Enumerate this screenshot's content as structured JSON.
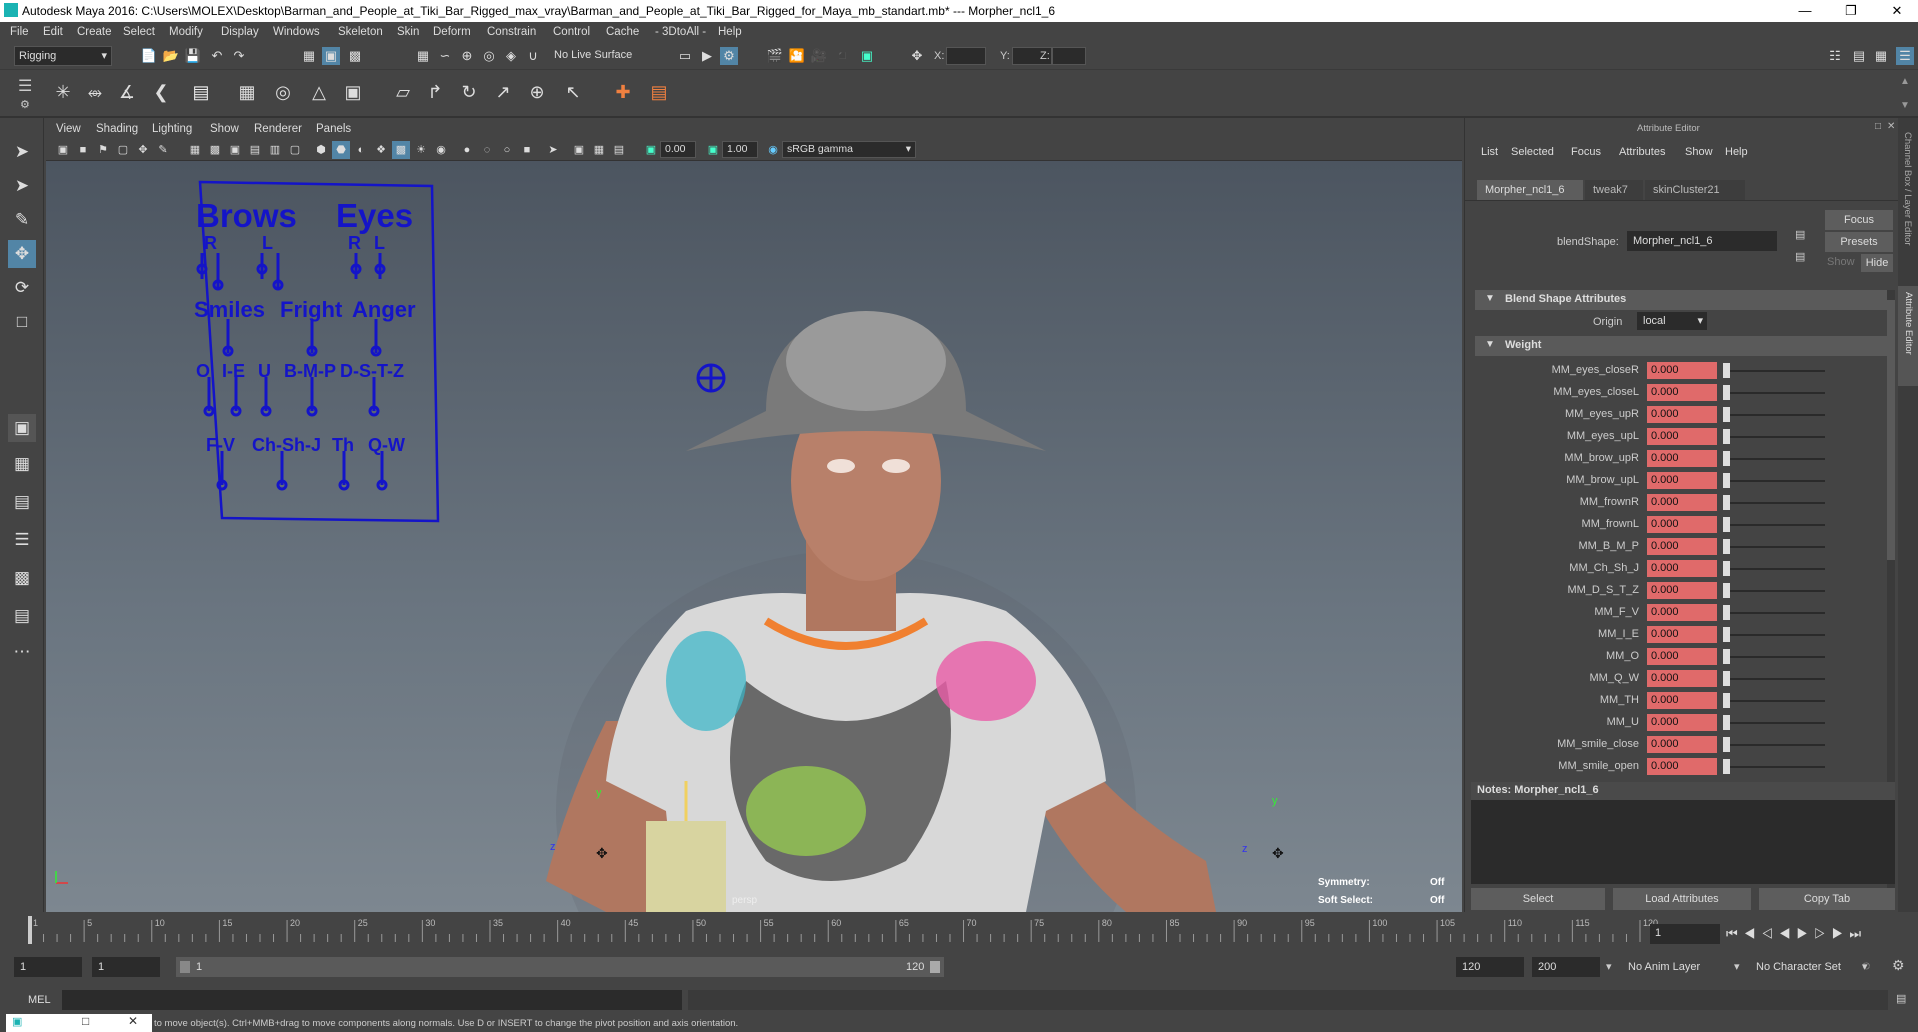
{
  "app": {
    "title": "Autodesk Maya 2016: C:\\Users\\MOLEX\\Desktop\\Barman_and_People_at_Tiki_Bar_Rigged_max_vray\\Barman_and_People_at_Tiki_Bar_Rigged_for_Maya_mb_standart.mb*   ---   Morpher_ncl1_6"
  },
  "menus": [
    "File",
    "Edit",
    "Create",
    "Select",
    "Modify",
    "Display",
    "Windows",
    "Skeleton",
    "Skin",
    "Deform",
    "Constrain",
    "Control",
    "Cache",
    "- 3DtoAll -",
    "Help"
  ],
  "status_line": {
    "mode": "Rigging",
    "live_surface": "No Live Surface",
    "x_label": "X:",
    "y_label": "Y:",
    "z_label": "Z:"
  },
  "viewport": {
    "menus": [
      "View",
      "Shading",
      "Lighting",
      "Show",
      "Renderer",
      "Panels"
    ],
    "exposure": "0.00",
    "gamma": "1.00",
    "color_space": "sRGB gamma",
    "camera": "persp",
    "symmetry_label": "Symmetry:",
    "symmetry_value": "Off",
    "soft_select_label": "Soft Select:",
    "soft_select_value": "Off",
    "face_rig": {
      "brows": "Brows",
      "eyes": "Eyes",
      "r1": "R",
      "l1": "L",
      "r2": "R",
      "l2": "L",
      "smiles": "Smiles",
      "fright": "Fright",
      "anger": "Anger",
      "o": "O",
      "ie": "I-E",
      "u": "U",
      "bmp": "B-M-P",
      "dstz": "D-S-T-Z",
      "fv": "F-V",
      "chshj": "Ch-Sh-J",
      "th": "Th",
      "qw": "Q-W"
    },
    "axis_y": "y",
    "axis_z": "z"
  },
  "attribute_editor": {
    "header": "Attribute Editor",
    "menus": [
      "List",
      "Selected",
      "Focus",
      "Attributes",
      "Show",
      "Help"
    ],
    "tabs": [
      "Morpher_ncl1_6",
      "tweak7",
      "skinCluster21"
    ],
    "node_label": "blendShape:",
    "node_value": "Morpher_ncl1_6",
    "focus_btn": "Focus",
    "presets_btn": "Presets",
    "show_btn": "Show",
    "hide_btn": "Hide",
    "section1": "Blend Shape Attributes",
    "origin_label": "Origin",
    "origin_value": "local",
    "section2": "Weight",
    "weights": [
      {
        "name": "MM_eyes_closeR",
        "value": "0.000"
      },
      {
        "name": "MM_eyes_closeL",
        "value": "0.000"
      },
      {
        "name": "MM_eyes_upR",
        "value": "0.000"
      },
      {
        "name": "MM_eyes_upL",
        "value": "0.000"
      },
      {
        "name": "MM_brow_upR",
        "value": "0.000"
      },
      {
        "name": "MM_brow_upL",
        "value": "0.000"
      },
      {
        "name": "MM_frownR",
        "value": "0.000"
      },
      {
        "name": "MM_frownL",
        "value": "0.000"
      },
      {
        "name": "MM_B_M_P",
        "value": "0.000"
      },
      {
        "name": "MM_Ch_Sh_J",
        "value": "0.000"
      },
      {
        "name": "MM_D_S_T_Z",
        "value": "0.000"
      },
      {
        "name": "MM_F_V",
        "value": "0.000"
      },
      {
        "name": "MM_I_E",
        "value": "0.000"
      },
      {
        "name": "MM_O",
        "value": "0.000"
      },
      {
        "name": "MM_Q_W",
        "value": "0.000"
      },
      {
        "name": "MM_TH",
        "value": "0.000"
      },
      {
        "name": "MM_U",
        "value": "0.000"
      },
      {
        "name": "MM_smile_close",
        "value": "0.000"
      },
      {
        "name": "MM_smile_open",
        "value": "0.000"
      }
    ],
    "notes": "Notes:  Morpher_ncl1_6",
    "select_btn": "Select",
    "load_btn": "Load Attributes",
    "copy_btn": "Copy Tab",
    "side_tab1": "Channel Box / Layer Editor",
    "side_tab2": "Attribute Editor"
  },
  "timeline": {
    "ticks": [
      "1",
      "5",
      "10",
      "15",
      "20",
      "25",
      "30",
      "35",
      "40",
      "45",
      "50",
      "55",
      "60",
      "65",
      "70",
      "75",
      "80",
      "85",
      "90",
      "95",
      "100",
      "105",
      "110",
      "115",
      "120"
    ],
    "current_frame": "1"
  },
  "range": {
    "start": "1",
    "start2": "1",
    "slider_start": "1",
    "slider_end": "120",
    "end": "120",
    "end2": "200",
    "anim_layer": "No Anim Layer",
    "char_set": "No Character Set"
  },
  "command": {
    "lang": "MEL"
  },
  "help_line": "to move object(s). Ctrl+MMB+drag to move components along normals. Use D or INSERT to change the pivot position and axis orientation."
}
